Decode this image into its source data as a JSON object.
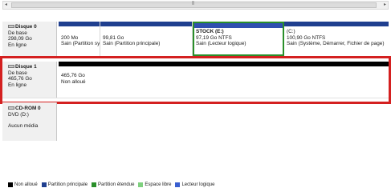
{
  "scrollbar": {
    "left_arrow": "◂",
    "right_arrow": "▸",
    "grip": "|||"
  },
  "disks": [
    {
      "name": "Disque 0",
      "type": "De base",
      "size": "298,09 Go",
      "status": "En ligne",
      "partitions": [
        {
          "label": "",
          "size": "200 Mo",
          "status": "Sain (Partition système, Actif, Partition principale)",
          "kind": "primary"
        },
        {
          "label": "",
          "size": "99,81 Go",
          "status": "Sain (Partition principale)",
          "kind": "primary"
        },
        {
          "label": "STOCK  (E:)",
          "size": "97,19 Go NTFS",
          "status": "Sain (Lecteur logique)",
          "kind": "logical",
          "selected": true
        },
        {
          "label": "(C:)",
          "size": "100,90 Go NTFS",
          "status": "Sain (Système, Démarrer, Fichier de page)",
          "kind": "primary"
        }
      ]
    },
    {
      "name": "Disque 1",
      "type": "De base",
      "size": "465,76 Go",
      "status": "En ligne",
      "partitions": [
        {
          "label": "",
          "size": "465,76 Go",
          "status": "Non alloué",
          "kind": "unallocated"
        }
      ]
    },
    {
      "name": "CD-ROM 0",
      "type": "DVD (D:)",
      "size": "",
      "status": "Aucun média",
      "partitions": []
    }
  ],
  "legend": [
    {
      "label": "Non alloué",
      "color": "#000000"
    },
    {
      "label": "Partition principale",
      "color": "#1f3f8f"
    },
    {
      "label": "Partition étendue",
      "color": "#2a8f2a"
    },
    {
      "label": "Espace libre",
      "color": "#7fd07f"
    },
    {
      "label": "Lecteur logique",
      "color": "#3a5fd0"
    }
  ]
}
